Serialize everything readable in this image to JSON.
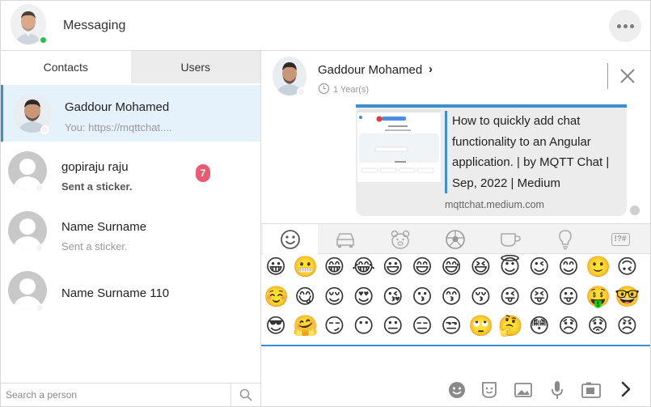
{
  "app": {
    "title": "Messaging"
  },
  "tabs": {
    "contacts": "Contacts",
    "users": "Users"
  },
  "contacts": [
    {
      "name": "Gaddour Mohamed",
      "preview": "You: https://mqttchat....",
      "selected": true
    },
    {
      "name": "gopiraju raju",
      "preview": "Sent a sticker.",
      "badge": "7",
      "unread": true
    },
    {
      "name": "Name Surname",
      "preview": "Sent a sticker."
    },
    {
      "name": "Name Surname 110",
      "preview": ""
    }
  ],
  "search": {
    "placeholder": "Search a person"
  },
  "chat": {
    "name": "Gaddour Mohamed",
    "chevron": "›",
    "last_seen": "1 Year(s)",
    "link_preview": {
      "title": "How to quickly add chat functionality to an Angular application. | by MQTT Chat | Sep, 2022 | Medium",
      "domain": "mqttchat.medium.com"
    }
  },
  "emoji_categories": [
    "smileys-icon",
    "car-icon",
    "bear-icon",
    "soccer-ball-icon",
    "cup-icon",
    "lightbulb-icon",
    "symbols-icon"
  ],
  "symbols_label": "!?#",
  "emojis": [
    [
      "😀",
      "😬",
      "😁",
      "😂",
      "😃",
      "😄",
      "😅",
      "😆",
      "😇",
      "😉",
      "😊",
      "🙂",
      "🙃"
    ],
    [
      "☺️",
      "😋",
      "😌",
      "😍",
      "😘",
      "😗",
      "😙",
      "😚",
      "😜",
      "😝",
      "😛",
      "🤑",
      "🤓"
    ],
    [
      "😎",
      "🤗",
      "😏",
      "😶",
      "😐",
      "😑",
      "😒",
      "🙄",
      "🤔",
      "😳",
      "😞",
      "😟",
      "😠"
    ]
  ],
  "colors": {
    "accent": "#3d8fd1",
    "online": "#2bbd4e",
    "badge": "#e95b73"
  }
}
